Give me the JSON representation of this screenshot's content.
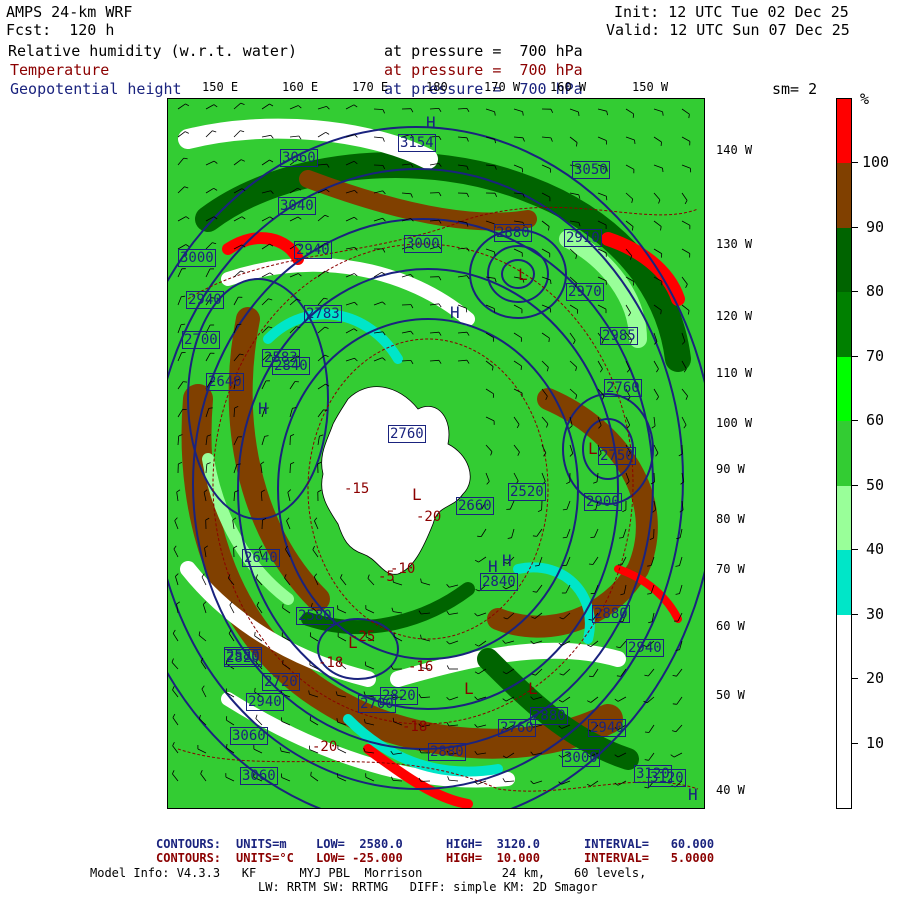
{
  "header": {
    "title": "AMPS 24-km WRF",
    "forecast": "Fcst:  120 h",
    "init": "Init: 12 UTC Tue 02 Dec 25",
    "valid": "Valid: 12 UTC Sun 07 Dec 25",
    "sm": "sm= 2"
  },
  "fields": [
    {
      "name": "Relative humidity (w.r.t. water)",
      "level": "at pressure =  700 hPa",
      "color": "#000000"
    },
    {
      "name": "Temperature",
      "level": "at pressure =  700 hPa",
      "color": "#8b0000"
    },
    {
      "name": "Geopotential height",
      "level": "at pressure =  700 hPa",
      "color": "#1a237e"
    }
  ],
  "lon_labels": [
    "150 E",
    "160 E",
    "170 E",
    "180",
    "170 W",
    "160 W",
    "150 W"
  ],
  "lat_labels": [
    "140 W",
    "130 W",
    "120 W",
    "110 W",
    "100 W",
    "90 W",
    "80 W",
    "70 W",
    "60 W",
    "50 W",
    "40 W"
  ],
  "colorbar": {
    "unit": "%",
    "labels": [
      "10",
      "20",
      "30",
      "40",
      "50",
      "60",
      "70",
      "80",
      "90",
      "100"
    ],
    "colors": [
      "#ffffff",
      "#ffffff",
      "#ffffff",
      "#00e6c8",
      "#99ff99",
      "#33cc33",
      "#00ff00",
      "#008000",
      "#006400",
      "#804000",
      "#ff0000"
    ]
  },
  "height_contour_labels": [
    "3060",
    "3154",
    "3050",
    "3040",
    "3000",
    "3000",
    "2880",
    "2910",
    "2970",
    "2985",
    "2940",
    "2940",
    "2840",
    "2783",
    "2760",
    "2700",
    "2640",
    "2583",
    "2750",
    "2900",
    "2760",
    "2640",
    "2660",
    "2580",
    "2520",
    "2580",
    "2720",
    "2840",
    "2880",
    "2940",
    "2820",
    "2700",
    "2880",
    "2940",
    "2760",
    "2880",
    "2820",
    "2940",
    "3000",
    "3060",
    "3120",
    "3060",
    "3120"
  ],
  "temperature_labels": [
    "-15",
    "-20",
    "-25",
    "-18",
    "-16",
    "-10",
    "-5",
    "-20",
    "-18"
  ],
  "pressure_symbols": [
    "H",
    "H",
    "L",
    "L",
    "L",
    "H",
    "L",
    "H",
    "H",
    "L",
    "L",
    "H"
  ],
  "footer": {
    "line1": {
      "label": "CONTOURS:",
      "units": "UNITS=m",
      "low": "LOW=  2580.0",
      "high": "HIGH=  3120.0",
      "interval": "INTERVAL=   60.000"
    },
    "line2": {
      "label": "CONTOURS:",
      "units": "UNITS=°C",
      "low": "LOW= -25.000",
      "high": "HIGH=  10.000",
      "interval": "INTERVAL=   5.0000"
    },
    "line3": "Model Info: V4.3.3   KF      MYJ PBL  Morrison           24 km,    60 levels,",
    "line4": "LW: RRTM SW: RRTMG   DIFF: simple KM: 2D Smagor"
  }
}
